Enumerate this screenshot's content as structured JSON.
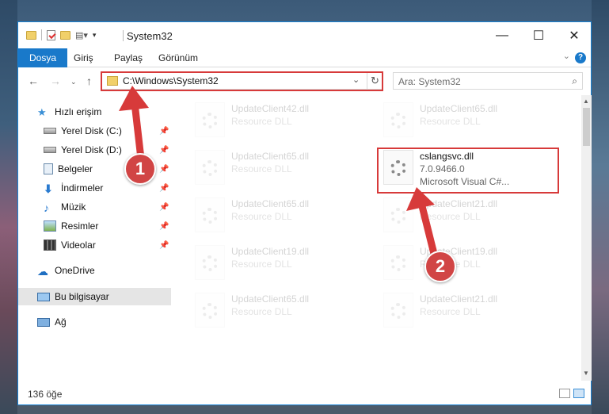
{
  "window": {
    "title": "System32"
  },
  "ribbon": {
    "tabs": [
      "Dosya",
      "Giriş",
      "Paylaş",
      "Görünüm"
    ]
  },
  "address": {
    "path": "C:\\Windows\\System32"
  },
  "search": {
    "placeholder": "Ara: System32"
  },
  "sidebar": {
    "items": [
      {
        "label": "Hızlı erişim",
        "icon": "star-icon"
      },
      {
        "label": "Yerel Disk (C:)",
        "icon": "drive-icon",
        "pinned": true
      },
      {
        "label": "Yerel Disk (D:)",
        "icon": "drive-icon",
        "pinned": true
      },
      {
        "label": "Belgeler",
        "icon": "documents-icon",
        "pinned": true
      },
      {
        "label": "İndirmeler",
        "icon": "download-icon",
        "pinned": true
      },
      {
        "label": "Müzik",
        "icon": "music-icon",
        "pinned": true
      },
      {
        "label": "Resimler",
        "icon": "pictures-icon",
        "pinned": true
      },
      {
        "label": "Videolar",
        "icon": "videos-icon",
        "pinned": true
      },
      {
        "label": "OneDrive",
        "icon": "cloud-icon"
      },
      {
        "label": "Bu bilgisayar",
        "icon": "computer-icon",
        "selected": true
      },
      {
        "label": "Ağ",
        "icon": "network-icon"
      }
    ]
  },
  "files": [
    {
      "name": "UpdateClient42.dll",
      "sub": "Resource DLL",
      "faded": true
    },
    {
      "name": "UpdateClient65.dll",
      "sub": "Resource DLL",
      "faded": true
    },
    {
      "name": "UpdateClient65.dll",
      "sub": "Resource DLL",
      "faded": true
    },
    {
      "name": "cslangsvc.dll",
      "sub": "7.0.9466.0",
      "sub2": "Microsoft Visual C#...",
      "faded": false
    },
    {
      "name": "UpdateClient65.dll",
      "sub": "Resource DLL",
      "faded": true
    },
    {
      "name": "UpdateClient21.dll",
      "sub": "Resource DLL",
      "faded": true
    },
    {
      "name": "UpdateClient19.dll",
      "sub": "Resource DLL",
      "faded": true
    },
    {
      "name": "UpdateClient19.dll",
      "sub": "Resource DLL",
      "faded": true
    },
    {
      "name": "UpdateClient65.dll",
      "sub": "Resource DLL",
      "faded": true
    },
    {
      "name": "UpdateClient21.dll",
      "sub": "Resource DLL",
      "faded": true
    }
  ],
  "status": {
    "count": "136 öğe"
  },
  "annotations": {
    "badge1": "1",
    "badge2": "2",
    "color": "#d73a3a"
  }
}
